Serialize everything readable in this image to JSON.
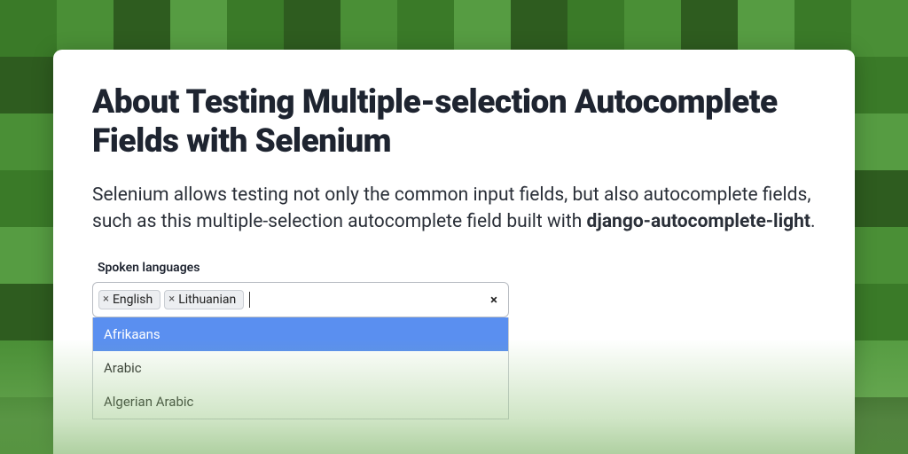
{
  "title": "About Testing Multiple-selection Autocomplete Fields with Selenium",
  "intro_pre": "Selenium allows testing not only the common input fields, but also autocomplete fields, such as this multiple-selection autocomplete field built with ",
  "intro_strong": "django-autocomplete-light",
  "intro_post": ".",
  "field": {
    "label": "Spoken languages",
    "selected": [
      {
        "label": "English"
      },
      {
        "label": "Lithuanian"
      }
    ],
    "clear_icon": "×",
    "remove_icon": "×"
  },
  "dropdown": {
    "options": [
      {
        "label": "Afrikaans",
        "highlighted": true
      },
      {
        "label": "Arabic",
        "highlighted": false
      },
      {
        "label": "Algerian Arabic",
        "highlighted": false
      }
    ]
  }
}
